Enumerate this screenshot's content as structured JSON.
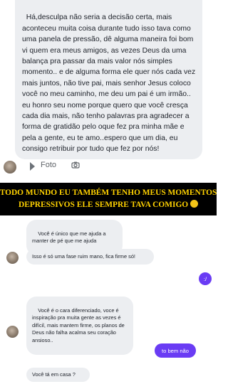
{
  "top_message": {
    "text": "Há,desculpa não seria a decisão certa, mais aconteceu muita coisa durante tudo isso tava como uma panela de pressão, dê alguma maneira foi bom vi quem era meus amigos, as vezes Deus da uma balança pra passar da mais valor nós simples momento.. e de alguma forma ele quer nós cada vez mais juntos, não tive pai, mais senhor Jesus coloco você no meu caminho, me deu um pai é um irmão.. eu honro seu nome porque quero que você cresça cada dia mais, não tenho palavras pra agradecer a forma de gratidão pelo oque fez pra minha mãe e pela a gente, eu te amo..espero que um dia, eu consigo retribuir por tudo que fez por nós!"
  },
  "photo_row": {
    "label": "Foto"
  },
  "banner": {
    "line1": "TODO MUNDO EU TAMBÉM TENHO MEUS MOMENTOS",
    "line2": "DEPRESSIVOS ELE SEMPRE TAVA COMIGO"
  },
  "chat": {
    "messages": [
      {
        "text": "Você é único que me ajuda a manter de pé que me ajuda"
      },
      {
        "text": "Isso é só uma fase ruim mano, fica firme só!"
      },
      {
        "text": ":/"
      },
      {
        "text": "Você é o cara diferenciado, voce é inspiração pra muita gente as vezes é difícil, mais mantem firme, os planos de Deus não falha acalma seu coração ansioso.."
      },
      {
        "text": "to bem não"
      },
      {
        "text": "Você tá em casa ?"
      }
    ]
  },
  "colors": {
    "sent_bubble": "#6a3cf4",
    "received_bubble": "#eceef1",
    "banner_text": "#ffd200",
    "banner_bg": "#000000"
  }
}
